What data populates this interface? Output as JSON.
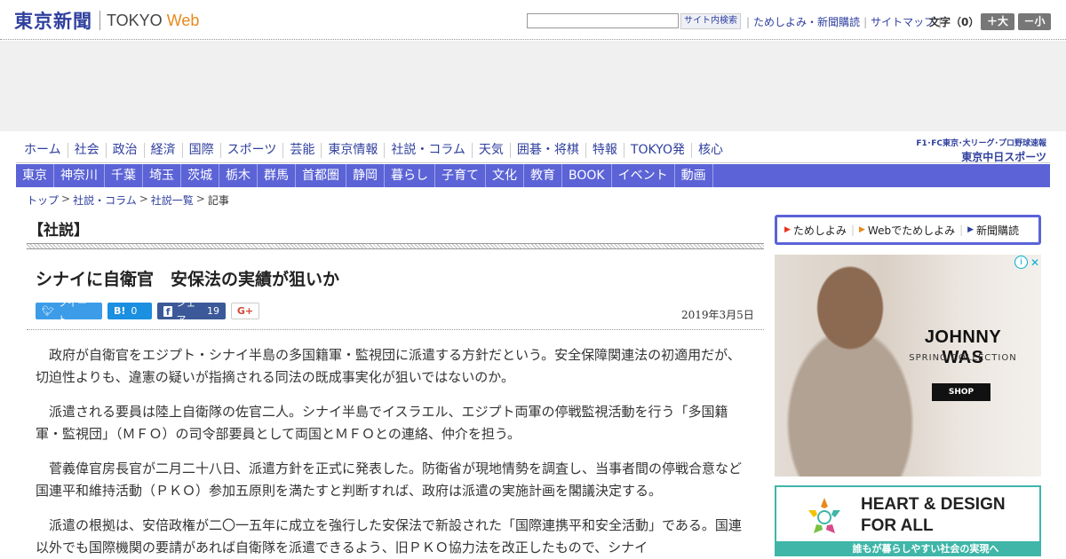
{
  "header": {
    "logo_jp": "東京新聞",
    "logo_tokyo": "TOKYO",
    "logo_web": "Web",
    "search_placeholder": "",
    "search_button": "サイト内検索",
    "util_links": [
      "ためしよみ・新聞購読",
      "サイトマップ"
    ],
    "font_size_label": "文字（0）",
    "font_plus": "＋大",
    "font_minus": "－小"
  },
  "nav_primary": [
    "ホーム",
    "社会",
    "政治",
    "経済",
    "国際",
    "スポーツ",
    "芸能",
    "東京情報",
    "社説・コラム",
    "天気",
    "囲碁・将棋",
    "特報",
    "TOKYO発",
    "核心"
  ],
  "chunichi": {
    "line1": "F1･FC東京･大リーグ･プロ野球速報",
    "line2": "東京中日スポーツ"
  },
  "nav_regional": [
    "東京",
    "神奈川",
    "千葉",
    "埼玉",
    "茨城",
    "栃木",
    "群馬",
    "首都圏",
    "静岡",
    "暮らし",
    "子育て",
    "文化",
    "教育",
    "BOOK",
    "イベント",
    "動画"
  ],
  "breadcrumb": [
    "トップ",
    "社説・コラム",
    "社説一覧"
  ],
  "breadcrumb_current": "記事",
  "article": {
    "section": "【社説】",
    "title": "シナイに自衛官　安保法の実績が狙いか",
    "date": "2019年3月5日",
    "share": {
      "twitter": "ツイート",
      "hatena_label": "B!",
      "hatena_count": "0",
      "facebook": "シェア",
      "facebook_count": "19",
      "gplus": "G+"
    },
    "paragraphs": [
      "政府が自衛官をエジプト・シナイ半島の多国籍軍・監視団に派遣する方針だという。安全保障関連法の初適用だが、切迫性よりも、違憲の疑いが指摘される同法の既成事実化が狙いではないのか。",
      "派遣される要員は陸上自衛隊の佐官二人。シナイ半島でイスラエル、エジプト両軍の停戦監視活動を行う「多国籍軍・監視団」（ＭＦＯ）の司令部要員として両国とＭＦＯとの連絡、仲介を担う。",
      "菅義偉官房長官が二月二十八日、派遣方針を正式に発表した。防衛省が現地情勢を調査し、当事者間の停戦合意など国連平和維持活動（ＰＫＯ）参加五原則を満たすと判断すれば、政府は派遣の実施計画を閣議決定する。",
      "派遣の根拠は、安倍政権が二〇一五年に成立を強行した安保法で新設された「国際連携平和安全活動」である。国連以外でも国際機関の要請があれば自衛隊を派遣できるよう、旧ＰＫＯ協力法を改正したもので、シナイ"
    ]
  },
  "sidebar": {
    "links": [
      "ためしよみ",
      "Webでためしよみ",
      "新聞購読"
    ],
    "ad1": {
      "brand": "JOHNNY WAS",
      "sub": "SPRING COLLECTION",
      "cta": "SHOP",
      "info": "i"
    },
    "ad2": {
      "line1": "HEART & DESIGN",
      "line2": "FOR ALL",
      "strip": "誰もが暮らしやすい社会の実現へ"
    }
  },
  "colors": {
    "brand": "#2f3f9e",
    "nav": "#5b63d6",
    "accent": "#e8891c",
    "heart": "#3fb6a8"
  }
}
